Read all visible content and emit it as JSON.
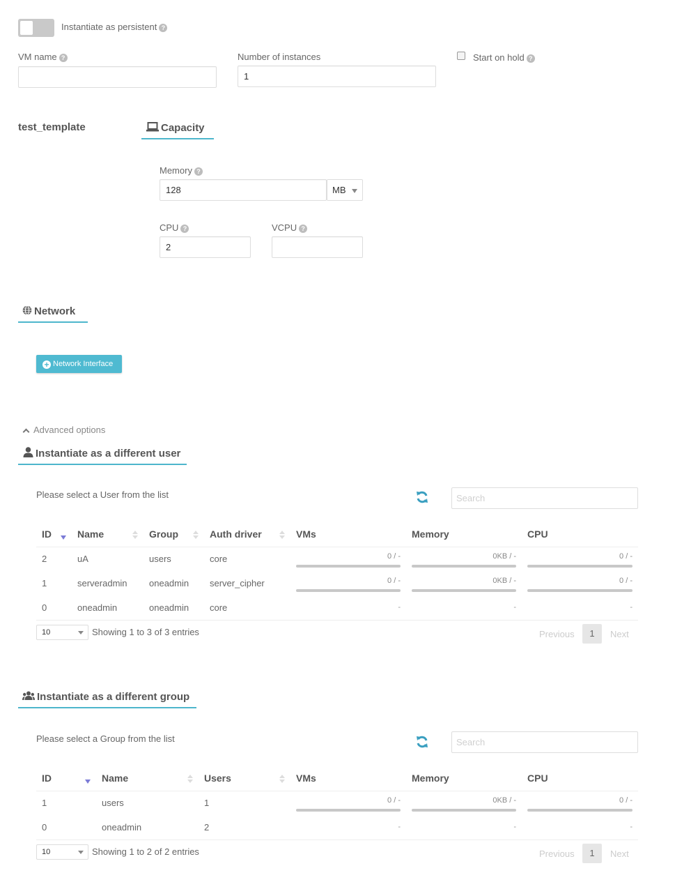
{
  "general": {
    "persistent_label": "Instantiate as persistent",
    "persistent_on": false,
    "vm_name_label": "VM name",
    "vm_name_value": "",
    "instances_label": "Number of instances",
    "instances_value": "1",
    "hold_label": "Start on hold",
    "hold_checked": false
  },
  "template": {
    "name": "test_template",
    "capacity_title": "Capacity",
    "memory_label": "Memory",
    "memory_value": "128",
    "memory_unit": "MB",
    "cpu_label": "CPU",
    "cpu_value": "2",
    "vcpu_label": "VCPU",
    "vcpu_value": ""
  },
  "network": {
    "title": "Network",
    "add_button": "Network Interface"
  },
  "advanced": {
    "toggle_label": "Advanced options"
  },
  "user_section": {
    "title": "Instantiate as a different user",
    "hint": "Please select a User from the list",
    "search_placeholder": "Search",
    "columns": [
      "ID",
      "Name",
      "Group",
      "Auth driver",
      "VMs",
      "Memory",
      "CPU"
    ],
    "rows": [
      {
        "id": "2",
        "name": "uA",
        "group": "users",
        "auth": "core",
        "vms": "0 / -",
        "memory": "0KB / -",
        "cpu": "0 / -",
        "has_bar": true
      },
      {
        "id": "1",
        "name": "serveradmin",
        "group": "oneadmin",
        "auth": "server_cipher",
        "vms": "0 / -",
        "memory": "0KB / -",
        "cpu": "0 / -",
        "has_bar": true
      },
      {
        "id": "0",
        "name": "oneadmin",
        "group": "oneadmin",
        "auth": "core",
        "vms": "-",
        "memory": "-",
        "cpu": "-",
        "has_bar": false
      }
    ],
    "page_size": "10",
    "info": "Showing 1 to 3 of 3 entries",
    "prev": "Previous",
    "page": "1",
    "next": "Next"
  },
  "group_section": {
    "title": "Instantiate as a different group",
    "hint": "Please select a Group from the list",
    "search_placeholder": "Search",
    "columns": [
      "ID",
      "Name",
      "Users",
      "VMs",
      "Memory",
      "CPU"
    ],
    "rows": [
      {
        "id": "1",
        "name": "users",
        "users": "1",
        "vms": "0 / -",
        "memory": "0KB / -",
        "cpu": "0 / -",
        "has_bar": true
      },
      {
        "id": "0",
        "name": "oneadmin",
        "users": "2",
        "vms": "-",
        "memory": "-",
        "cpu": "-",
        "has_bar": false
      }
    ],
    "page_size": "10",
    "info": "Showing 1 to 2 of 2 entries",
    "prev": "Previous",
    "page": "1",
    "next": "Next"
  },
  "colors": {
    "accent": "#4db6cc",
    "button": "#4fbad1",
    "refresh": "#3a9fc0",
    "sort_active": "#7b7bd6"
  }
}
